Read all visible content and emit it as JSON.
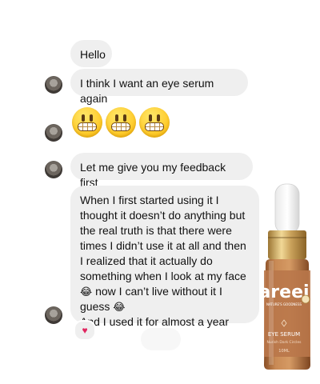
{
  "messages": [
    {
      "id": "m1",
      "text": "Hello"
    },
    {
      "id": "m2",
      "text": "I think I want an eye serum again"
    },
    {
      "id": "m3",
      "emojis": [
        "grimacing-face",
        "grimacing-face",
        "grimacing-face"
      ]
    },
    {
      "id": "m4",
      "text": "Let me give you my feedback first"
    },
    {
      "id": "m5",
      "line1": "When I first started using it I",
      "line2": "thought it doesn’t do anything but",
      "line3": "the real truth is that there were",
      "line4": "times I didn’t use it at all and then",
      "line5": "I realized that it actually do",
      "line6": "something when I look at my face",
      "line7_emoji": "😂",
      "line7_text": " now I can’t live without it I",
      "line8_text": "guess ",
      "line8_emoji": "😂",
      "line9": "And I used it for almost a year",
      "reaction": "♥"
    }
  ],
  "product": {
    "brand": "areej",
    "tagline": "NATURE'S GOODNESS",
    "name": "EYE SERUM",
    "sub": "Nurish Dark Circles",
    "volume": "10ML"
  },
  "colors": {
    "bubble": "#efefef",
    "bottle_amber": "#b56e3c",
    "cap_gold": "#c9a15a"
  }
}
